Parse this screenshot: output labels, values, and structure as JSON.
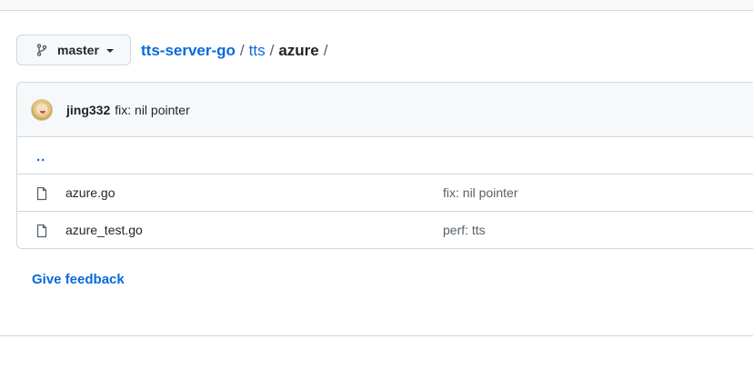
{
  "branch": {
    "name": "master"
  },
  "breadcrumb": {
    "repo": "tts-server-go",
    "segments": [
      "tts"
    ],
    "current": "azure",
    "separator": "/"
  },
  "latest_commit": {
    "author": "jing332",
    "message": "fix: nil pointer"
  },
  "files": {
    "parent_link": "..",
    "items": [
      {
        "name": "azure.go",
        "commit_message": "fix: nil pointer",
        "icon": "file-icon"
      },
      {
        "name": "azure_test.go",
        "commit_message": "perf: tts",
        "icon": "file-icon"
      }
    ]
  },
  "feedback": {
    "label": "Give feedback"
  },
  "colors": {
    "link": "#0969da",
    "border": "#d0d7de",
    "muted": "#57606a",
    "subtle_bg": "#f6f8fa"
  }
}
